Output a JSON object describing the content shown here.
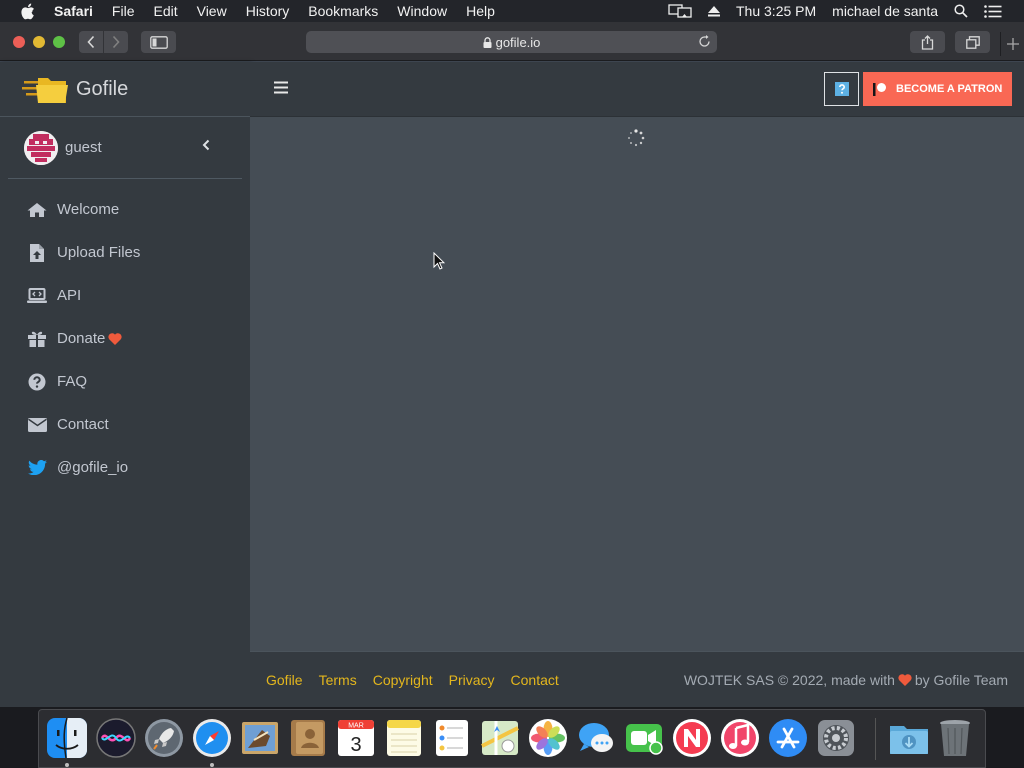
{
  "menubar": {
    "app_name": "Safari",
    "items": [
      "File",
      "Edit",
      "View",
      "History",
      "Bookmarks",
      "Window",
      "Help"
    ],
    "clock": "Thu 3:25 PM",
    "user": "michael de santa"
  },
  "browser": {
    "url": "gofile.io"
  },
  "app": {
    "brand": "Gofile",
    "user": "guest",
    "nav": [
      {
        "label": "Welcome",
        "icon": "home-icon"
      },
      {
        "label": "Upload Files",
        "icon": "file-upload-icon"
      },
      {
        "label": "API",
        "icon": "laptop-code-icon"
      },
      {
        "label": "Donate",
        "icon": "gift-icon"
      },
      {
        "label": "FAQ",
        "icon": "question-circle-icon"
      },
      {
        "label": "Contact",
        "icon": "envelope-icon"
      },
      {
        "label": "@gofile_io",
        "icon": "twitter-icon"
      }
    ],
    "patron_button": "BECOME A PATRON"
  },
  "footer": {
    "links": [
      "Gofile",
      "Terms",
      "Copyright",
      "Privacy",
      "Contact"
    ],
    "credit_left": "WOJTEK SAS © 2022, made with",
    "credit_right": "by Gofile Team"
  },
  "dock": {
    "apps": [
      "Finder",
      "Siri",
      "Launchpad",
      "Safari",
      "Mail",
      "Contacts",
      "Calendar",
      "Notes",
      "Reminders",
      "Maps",
      "Photos",
      "Messages",
      "FaceTime",
      "News",
      "iTunes",
      "App Store",
      "System Preferences",
      "Downloads",
      "Trash"
    ],
    "calendar_month": "MAR",
    "calendar_day": "3"
  },
  "colors": {
    "accent_link": "#e3b61d",
    "patron": "#f96854",
    "sidebar_bg": "#343a40",
    "content_bg": "#454d55"
  }
}
